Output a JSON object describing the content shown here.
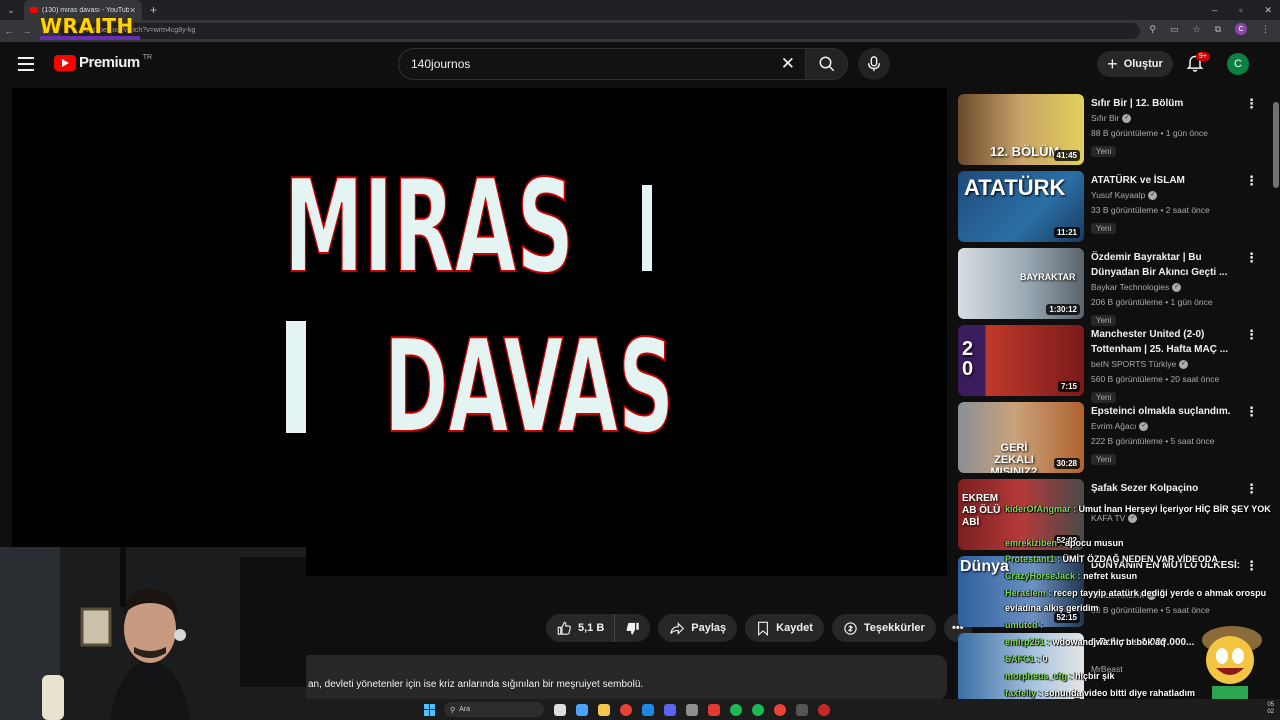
{
  "browser": {
    "tab_title": "(130) miras davası - YouTube",
    "url": "youtube.com/watch?v=wrm4cg8y-kg",
    "profile_initial": "C"
  },
  "overlay": {
    "brand": "WRAITH"
  },
  "masthead": {
    "logo_text": "Premium",
    "country_code": "TR",
    "search_value": "140journos",
    "create_label": "Oluştur",
    "notification_count": "9+",
    "avatar_initial": "C"
  },
  "player": {
    "title_line1": "MIRAS",
    "title_line2": "DAVAS"
  },
  "actions": {
    "like_count": "5,1 B",
    "share_label": "Paylaş",
    "save_label": "Kaydet",
    "thanks_label": "Teşekkürler"
  },
  "description": {
    "text": "an, devleti yönetenler için ise kriz anlarında sığınılan bir meşruiyet sembolü."
  },
  "sidebar": {
    "videos": [
      {
        "title": "Sıfır Bir | 12. Bölüm",
        "channel": "Sıfır Bir",
        "stats": "88 B görüntüleme • 1 gün önce",
        "badge": "Yeni",
        "duration": "41:45",
        "thumb_text": "12. BÖLÜM"
      },
      {
        "title": "ATATÜRK ve İSLAM",
        "channel": "Yusuf Kayaalp",
        "stats": "33 B görüntüleme • 2 saat önce",
        "badge": "Yeni",
        "duration": "11:21",
        "thumb_text": "ATATÜRK"
      },
      {
        "title": "Özdemir Bayraktar | Bu Dünyadan Bir Akıncı Geçti ...",
        "channel": "Baykar Technologies",
        "stats": "206 B görüntüleme • 1 gün önce",
        "badge": "Yeni",
        "duration": "1:30:12",
        "thumb_text": "BAYRAKTAR"
      },
      {
        "title": "Manchester United (2-0) Tottenham | 25. Hafta MAÇ ...",
        "channel": "beIN SPORTS Türkiye",
        "stats": "560 B görüntüleme • 20 saat önce",
        "badge": "Yeni",
        "duration": "7:15",
        "thumb_text": "2 0"
      },
      {
        "title": "Epsteinci olmakla suçlandım.",
        "channel": "Evrim Ağacı",
        "stats": "222 B görüntüleme • 5 saat önce",
        "badge": "Yeni",
        "duration": "30:28",
        "thumb_text": "GERİ ZEKALI MISINIZ?"
      },
      {
        "title": "Şafak Sezer Kolpaçino",
        "channel": "KAFA TV",
        "stats": "",
        "badge": "",
        "duration": "52:02",
        "thumb_text": "EKREM AB ÖLÜ ABİ"
      },
      {
        "title": "DÜNYANIN EN MUTLU ÜLKESİ:",
        "channel": "AkademikLink",
        "stats": "53 B görüntüleme • 5 saat önce",
        "badge": "",
        "duration": "52:15",
        "thumb_text": "Dünya"
      },
      {
        "title": "1 Dolar vs 1.000.000...",
        "channel": "MrBeast",
        "stats": "",
        "badge": "",
        "duration": "",
        "thumb_text": ""
      }
    ]
  },
  "chat": [
    {
      "user": "kiderOfAngmar :",
      "msg": "Umut İnan Herşeyi İçeriyor HİÇ BİR ŞEY YOK"
    },
    {
      "user": "emrekiziben :",
      "msg": "apocu musun"
    },
    {
      "user": "Protestant1 :",
      "msg": "ÜMİT ÖZDAĞ NEDEN VAR VİDEODA"
    },
    {
      "user": "CrazyHorseJack :",
      "msg": "nefret kusun"
    },
    {
      "user": "Heraslem :",
      "msg": "recep tayyip atatürk dediği yerde o ahmak orospu"
    },
    {
      "user": "",
      "msg": "evladına alkış geridim"
    },
    {
      "user": "umutcd :",
      "msg": ""
    },
    {
      "user": "emirp251 :",
      "msg": "wdowandjwa hiç bi bok aq"
    },
    {
      "user": "SAFC1 :",
      "msg": "0"
    },
    {
      "user": "morpheus_cfg :",
      "msg": "hiçbir şik"
    },
    {
      "user": "faxfelly :",
      "msg": "sonunda video bitti diye rahatladım"
    }
  ],
  "taskbar": {
    "search_label": "Ara",
    "clock_time": "05",
    "clock_date": "02"
  }
}
